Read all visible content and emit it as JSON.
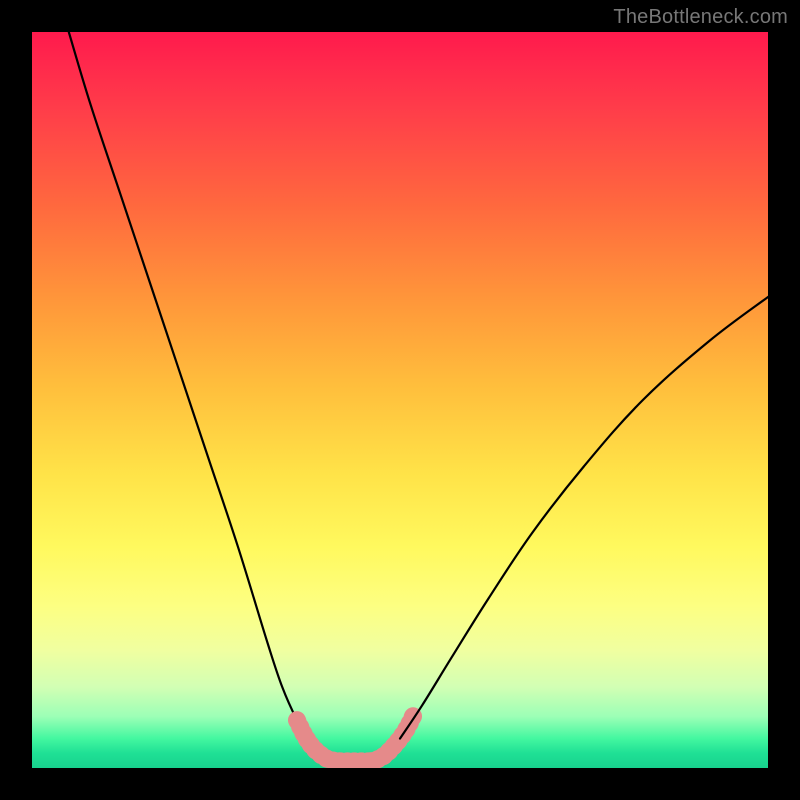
{
  "watermark": {
    "text": "TheBottleneck.com"
  },
  "chart_data": {
    "type": "line",
    "title": "",
    "xlabel": "",
    "ylabel": "",
    "xlim": [
      0,
      100
    ],
    "ylim": [
      0,
      100
    ],
    "background_gradient": {
      "top_color": "#ff1a4d",
      "mid_color": "#fff95e",
      "bottom_color": "#18d28e",
      "meaning": "red-high to green-low mismatch scale"
    },
    "series": [
      {
        "name": "left-branch",
        "style": "thin-black",
        "x": [
          5.0,
          8.0,
          12.0,
          16.0,
          20.0,
          24.0,
          28.0,
          32.0,
          34.0,
          36.0,
          37.5,
          38.5
        ],
        "y": [
          100.0,
          90.0,
          78.0,
          66.0,
          54.0,
          42.0,
          30.0,
          17.0,
          11.0,
          6.5,
          4.0,
          2.5
        ]
      },
      {
        "name": "left-bottom-pink",
        "style": "thick-pink",
        "x": [
          36.0,
          37.0,
          38.0,
          39.0,
          40.0,
          41.0,
          42.0,
          43.0,
          44.0,
          45.0,
          46.0
        ],
        "y": [
          6.5,
          4.5,
          3.0,
          2.0,
          1.3,
          1.0,
          0.9,
          0.9,
          0.9,
          0.9,
          0.9
        ]
      },
      {
        "name": "right-bottom-pink",
        "style": "thick-pink",
        "x": [
          46.0,
          47.0,
          48.0,
          49.0,
          50.0,
          51.0,
          52.0
        ],
        "y": [
          0.9,
          1.2,
          1.8,
          2.8,
          4.0,
          5.5,
          7.5
        ]
      },
      {
        "name": "right-branch",
        "style": "thin-black",
        "x": [
          50.0,
          53.0,
          57.0,
          62.0,
          68.0,
          75.0,
          83.0,
          92.0,
          100.0
        ],
        "y": [
          4.0,
          8.5,
          15.0,
          23.0,
          32.0,
          41.0,
          50.0,
          58.0,
          64.0
        ]
      }
    ],
    "annotations": []
  }
}
